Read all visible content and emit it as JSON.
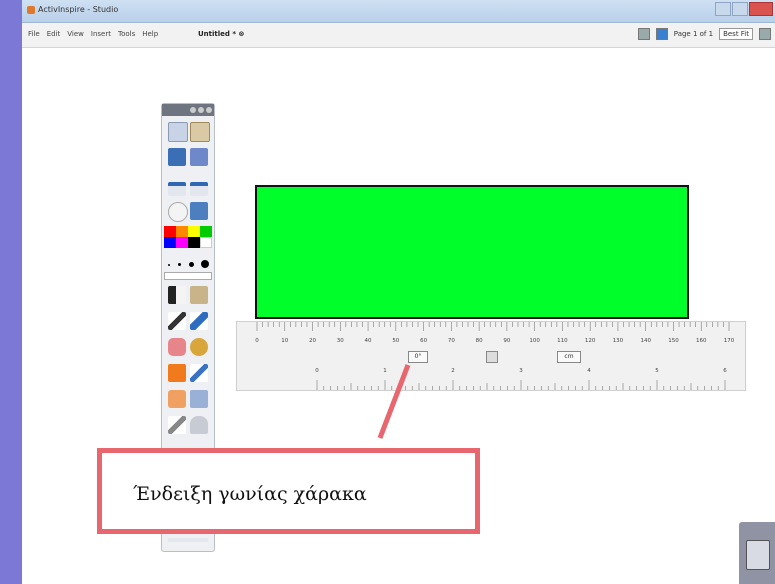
{
  "window": {
    "title": "ActivInspire - Studio"
  },
  "menu": {
    "items": [
      "File",
      "Edit",
      "View",
      "Insert",
      "Tools",
      "Help"
    ],
    "document_tab": "Untitled * ⊗",
    "page_indicator": "Page 1 of 1",
    "zoom_select": "Best Fit"
  },
  "ruler": {
    "top_ticks": [
      "0",
      "10",
      "20",
      "30",
      "40",
      "50",
      "60",
      "70",
      "80",
      "90",
      "100",
      "110",
      "120",
      "130",
      "140",
      "150",
      "160",
      "170"
    ],
    "bottom_ticks": [
      "0",
      "1",
      "2",
      "3",
      "4",
      "5",
      "6"
    ],
    "angle_readout": "0°",
    "unit_readout": "cm"
  },
  "shape": {
    "fill": "#00ff2a",
    "stroke": "#111111"
  },
  "palette": {
    "colors": [
      "#ff0000",
      "#ffff00",
      "#00cc00",
      "#0000ff",
      "#ff00ff",
      "#000000",
      "#ffffff"
    ]
  },
  "callout": {
    "text": "Ένδειξη γωνίας χάρακα",
    "border_color": "#e8666e"
  },
  "icons": [
    "close-icon",
    "page-view-icon",
    "trash-icon",
    "select-arrow-icon",
    "pen-icon",
    "highlighter-icon",
    "eraser-icon",
    "fill-icon",
    "pipette-icon",
    "magic-ink-icon"
  ]
}
